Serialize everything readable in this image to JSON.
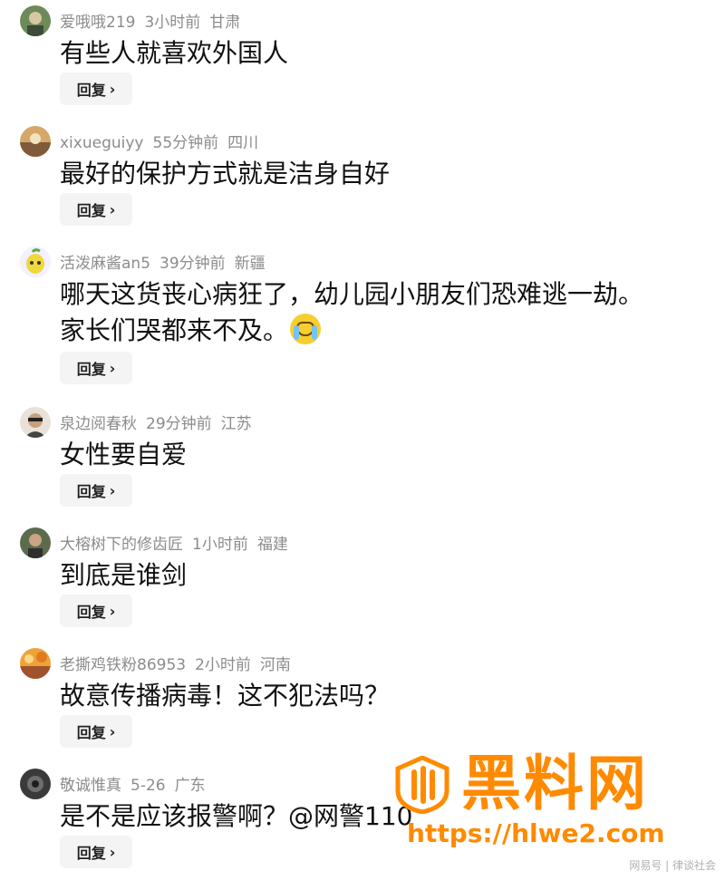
{
  "comments": [
    {
      "user": "爱哦哦219",
      "time": "3小时前",
      "region": "甘肃",
      "text": "有些人就喜欢外国人",
      "reply_label": "回复"
    },
    {
      "user": "xixueguiyy",
      "time": "55分钟前",
      "region": "四川",
      "text": "最好的保护方式就是洁身自好",
      "reply_label": "回复"
    },
    {
      "user": "活泼麻酱an5",
      "time": "39分钟前",
      "region": "新疆",
      "text": "哪天这货丧心病狂了，幼儿园小朋友们恐难逃一劫。",
      "text2": "家长们哭都来不及。",
      "reply_label": "回复"
    },
    {
      "user": "泉边阅春秋",
      "time": "29分钟前",
      "region": "江苏",
      "text": "女性要自爱",
      "reply_label": "回复"
    },
    {
      "user": "大榕树下的修齿匠",
      "time": "1小时前",
      "region": "福建",
      "text": "到底是谁剑",
      "reply_label": "回复"
    },
    {
      "user": "老撕鸡铁粉86953",
      "time": "2小时前",
      "region": "河南",
      "text": "故意传播病毒！这不犯法吗？",
      "reply_label": "回复"
    },
    {
      "user": "敬诚惟真",
      "time": "5-26",
      "region": "广东",
      "text": "是不是应该报警啊？@网警110",
      "reply_label": "回复"
    }
  ],
  "watermark": {
    "title": "黑料网",
    "url": "https://hlwe2.com"
  },
  "footer": {
    "credit": "网易号 | 律谈社会"
  },
  "colors": {
    "accent": "#ff8a00",
    "meta": "#8c8c8c",
    "text": "#111111",
    "reply_bg": "#f4f4f4"
  }
}
